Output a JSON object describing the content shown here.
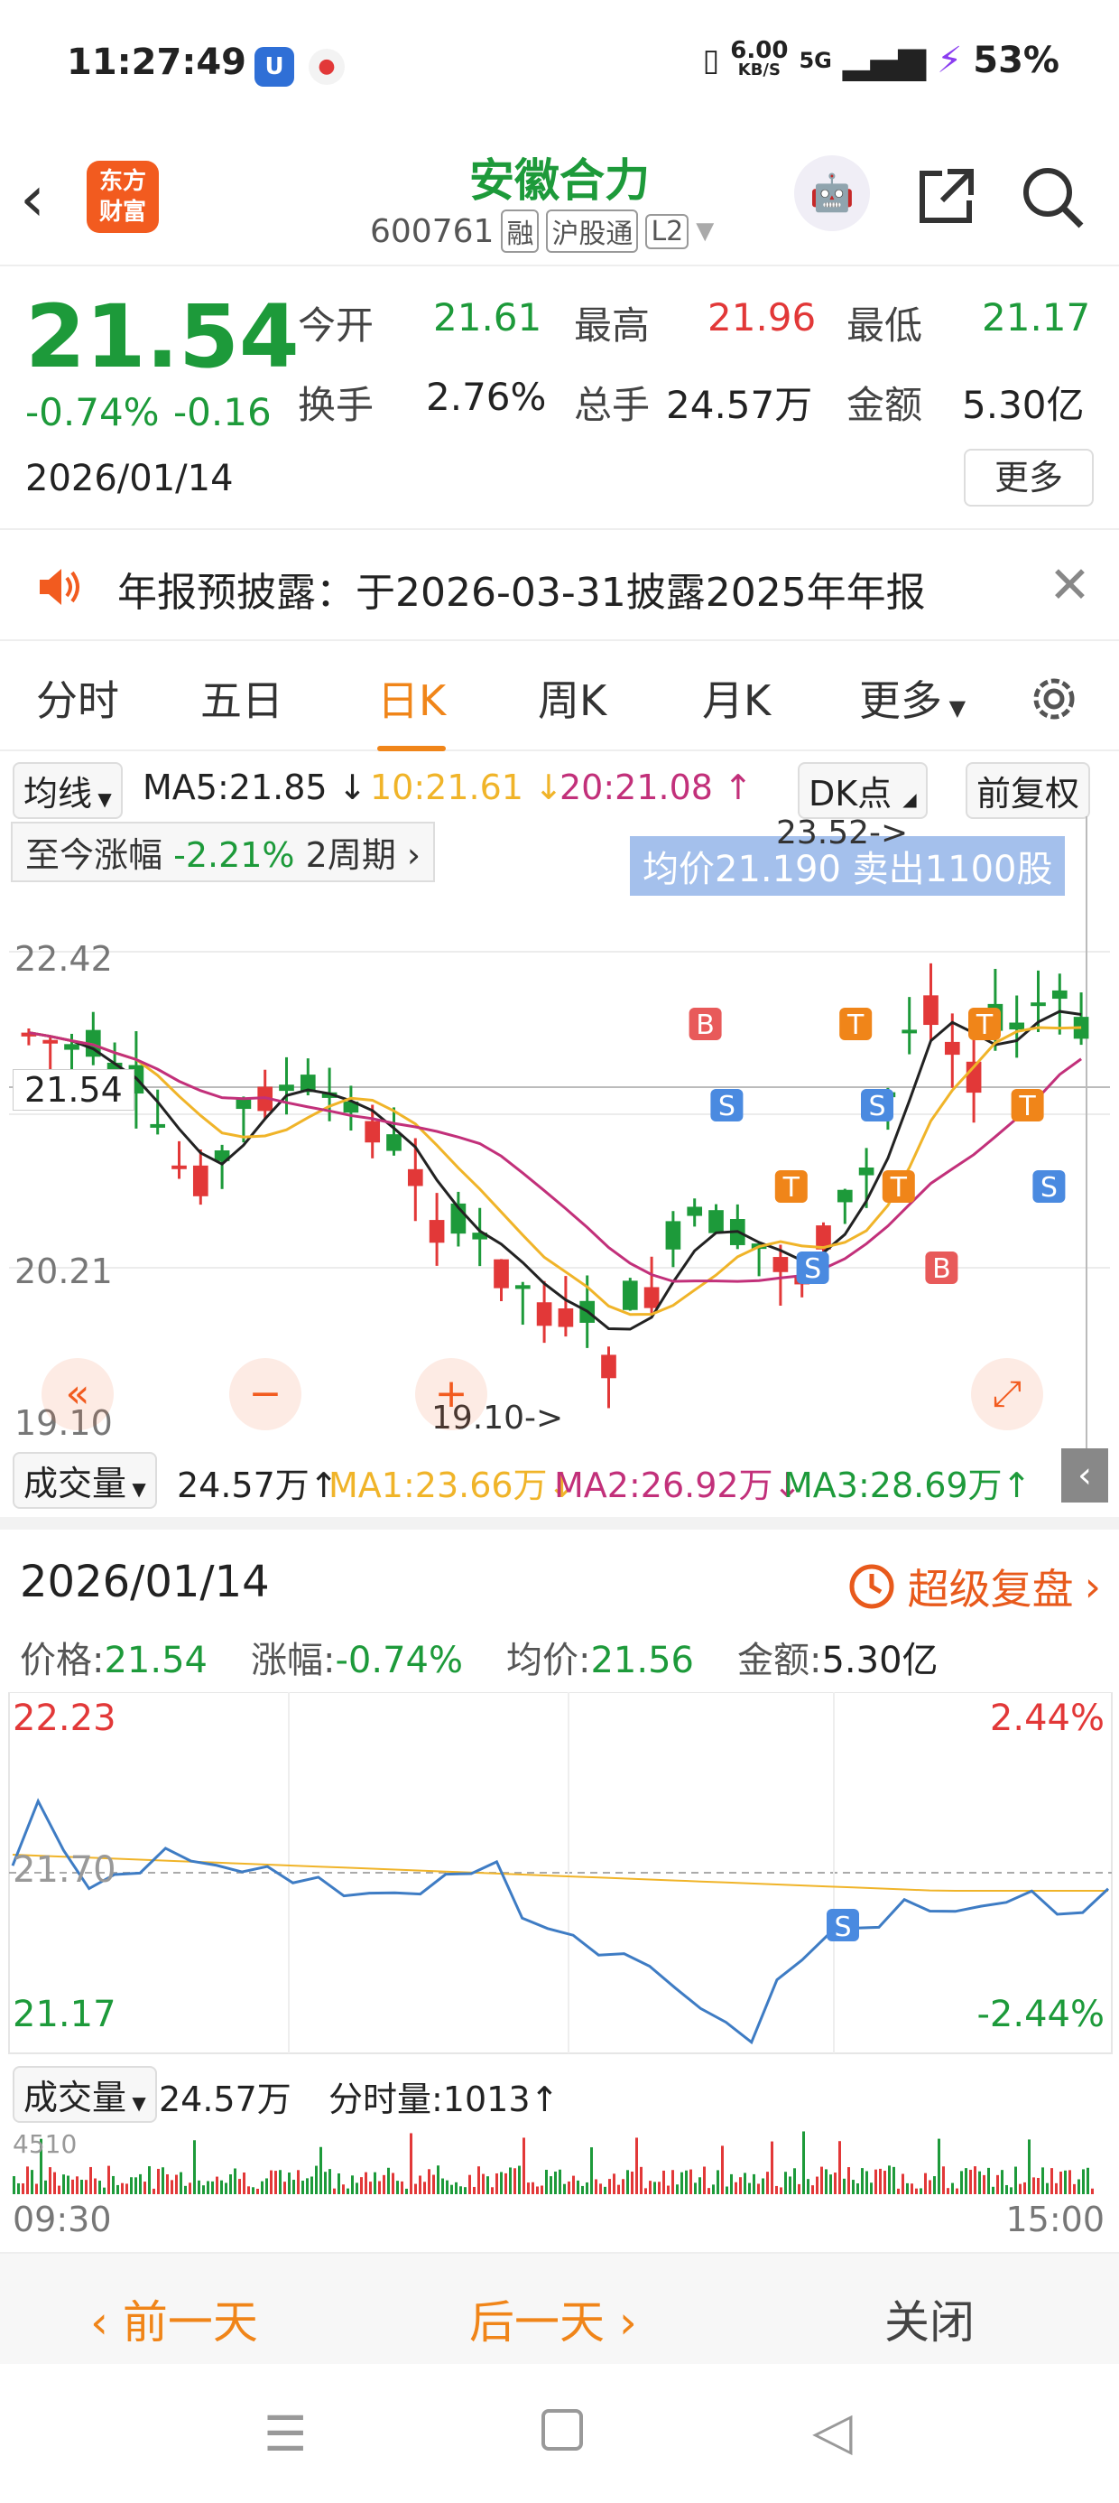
{
  "status_bar": {
    "time": "11:27:49",
    "speed": "6.00",
    "speed_unit": "KB/S",
    "network": "5G",
    "battery": "53%"
  },
  "header": {
    "logo_text_1": "东方",
    "logo_text_2": "财富",
    "stock_name": "安徽合力",
    "stock_code": "600761",
    "tag_margin": "融",
    "tag_connect": "沪股通",
    "tag_level": "L2"
  },
  "quote": {
    "price": "21.54",
    "change_pct": "-0.74%",
    "change_val": "-0.16",
    "date": "2026/01/14",
    "open_label": "今开",
    "open": "21.61",
    "high_label": "最高",
    "high": "21.96",
    "low_label": "最低",
    "low": "21.17",
    "turnover_label": "换手",
    "turnover": "2.76%",
    "volume_label": "总手",
    "volume": "24.57万",
    "amount_label": "金额",
    "amount": "5.30亿",
    "more_label": "更多"
  },
  "notice": {
    "text": "年报预披露：于2026-03-31披露2025年年报"
  },
  "tabs": [
    "分时",
    "五日",
    "日K",
    "周K",
    "月K",
    "更多"
  ],
  "active_tab": "日K",
  "ma_row": {
    "selector": "均线",
    "ma5": "MA5:21.85",
    "ma10": "10:21.61",
    "ma20": "20:21.08",
    "dk": "DK点",
    "adjust": "前复权"
  },
  "kchart": {
    "range_label": "至今涨幅",
    "range_value": "-2.21%",
    "period": "2周期",
    "banner": "均价21.190  卖出1100股",
    "max_label": "23.52->",
    "min_label": "19.10->",
    "axis_top": "22.42",
    "axis_mid": "20.21",
    "axis_bottom": "19.10",
    "crosshair_price": "21.54"
  },
  "vol_row": {
    "selector": "成交量",
    "vol": "24.57万",
    "ma1": "MA1:23.66万",
    "ma2": "MA2:26.92万",
    "ma3": "MA3:28.69万"
  },
  "detail": {
    "date": "2026/01/14",
    "replay": "超级复盘",
    "price": "价格:21.54",
    "change": "涨幅:-0.74%",
    "avg": "均价:21.56",
    "amount": "金额:5.30亿",
    "top_price": "22.23",
    "top_pct": "2.44%",
    "mid_price": "21.70",
    "bottom_price": "21.17",
    "bottom_pct": "-2.44%",
    "vol_selector": "成交量",
    "vol_total": "24.57万",
    "vol_tick": "分时量:1013",
    "vol_max": "4510",
    "time_start": "09:30",
    "time_end": "15:00"
  },
  "bottom_nav": {
    "prev": "前一天",
    "next": "后一天",
    "close": "关闭"
  },
  "colors": {
    "up": "#e23838",
    "down": "#1d9a3a",
    "accent": "#f08519",
    "ma5": "#222222",
    "ma10": "#f0b429",
    "ma20": "#c2307a",
    "intraday": "#3e7cc4"
  }
}
